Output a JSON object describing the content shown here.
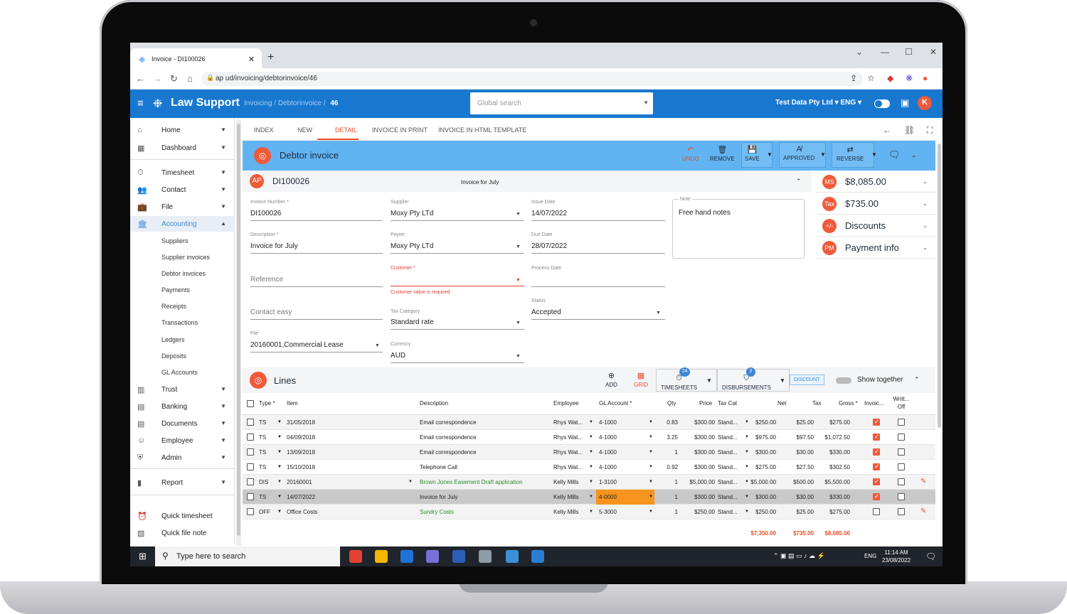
{
  "browser": {
    "tab_title": "Invoice - DI100026",
    "url": "ap          ud/invoicing/debtorinvoice/46"
  },
  "appbar": {
    "brand": "Law Support",
    "breadcrumb": [
      "Invoicing",
      "/",
      "Debtorinvoice",
      "/",
      "46"
    ],
    "search_placeholder": "Global search",
    "org": "Test Data Pty Ltd",
    "lang": "ENG",
    "avatar": "K"
  },
  "sidebar": {
    "items": [
      {
        "label": "Home",
        "icon": "home-icon"
      },
      {
        "label": "Dashboard",
        "icon": "dashboard-icon"
      },
      {
        "label": "Timesheet",
        "icon": "stopwatch-icon"
      },
      {
        "label": "Contact",
        "icon": "people-icon"
      },
      {
        "label": "File",
        "icon": "briefcase-icon"
      },
      {
        "label": "Accounting",
        "icon": "bank-icon"
      }
    ],
    "accounting_sub": [
      "Suppliers",
      "Supplier invoices",
      "Debtor invoices",
      "Payments",
      "Receipts",
      "Transactions",
      "Ledgers",
      "Deposits",
      "GL Accounts"
    ],
    "lower": [
      {
        "label": "Trust",
        "icon": "building-icon"
      },
      {
        "label": "Banking",
        "icon": "card-icon"
      },
      {
        "label": "Documents",
        "icon": "document-icon"
      },
      {
        "label": "Employee",
        "icon": "employee-icon"
      },
      {
        "label": "Admin",
        "icon": "shield-icon"
      },
      {
        "label": "Report",
        "icon": "report-icon"
      }
    ],
    "quick": [
      {
        "label": "Quick timesheet",
        "icon": "alarm-icon"
      },
      {
        "label": "Quick file note",
        "icon": "filenote-icon"
      }
    ]
  },
  "page_tabs": [
    "INDEX",
    "NEW",
    "DETAIL",
    "INVOICE IN PRINT",
    "INVOICE IN HTML TEMPLATE"
  ],
  "header": {
    "title": "Debtor invoice",
    "undo": "UNDO",
    "remove": "REMOVE",
    "save": "SAVE",
    "approved": "APPROVED",
    "reverse": "REVERSE"
  },
  "invoice": {
    "badge": "AP",
    "number": "DI100026",
    "subtitle": "Invoice for July",
    "fields": {
      "invoice_number_label": "Invoice Number *",
      "invoice_number": "DI100026",
      "supplier_label": "Supplier",
      "supplier": "Moxy Pty LTd",
      "issue_date_label": "Issue Date",
      "issue_date": "14/07/2022",
      "description_label": "Description *",
      "description": "Invoice for July",
      "payee_label": "Payee",
      "payee": "Moxy Pty LTd",
      "due_date_label": "Due Date",
      "due_date": "28/07/2022",
      "reference_ph": "Reference",
      "customer_label": "Customer *",
      "customer_error": "Customer value is required",
      "process_date_label": "Process Date",
      "contact_ph": "Contact easy",
      "tax_category_label": "Tax Category",
      "tax_category": "Standard rate",
      "status_label": "Status",
      "status": "Accepted",
      "file_label": "File",
      "file": "20160001,Commercial Lease",
      "currency_label": "Currency",
      "currency": "AUD",
      "note_label": "Note",
      "note": "Free hand notes"
    }
  },
  "summary": [
    {
      "badge": "MS",
      "label": "$8,085.00"
    },
    {
      "badge": "Tax",
      "label": "$735.00"
    },
    {
      "badge": "+/-",
      "label": "Discounts"
    },
    {
      "badge": "PM",
      "label": "Payment info"
    }
  ],
  "lines": {
    "title": "Lines",
    "add": "ADD",
    "grid": "GRID",
    "timesheets": "TIMESHEETS",
    "timesheets_count": "24",
    "disbursements": "DISBURSEMENTS",
    "disbursements_count": "2",
    "discount": "DISCOUNT",
    "show_together": "Show together",
    "headers": [
      "Type *",
      "Item",
      "Description",
      "Employee",
      "GL Account *",
      "Qty",
      "Price",
      "Tax Cat",
      "Net",
      "Tax",
      "Gross *",
      "Invoic...",
      "Writt... Off"
    ],
    "rows": [
      {
        "type": "TS",
        "item": "31/05/2018",
        "desc": "Email correspondence",
        "emp": "Rhys Wat...",
        "gl": "4-1000",
        "qty": "0.83",
        "price": "$300.00",
        "taxcat": "Stand...",
        "net": "$250.00",
        "tax": "$25.00",
        "gross": "$275.00",
        "inv": true
      },
      {
        "type": "TS",
        "item": "04/09/2018",
        "desc": "Email correspondence",
        "emp": "Rhys Wat...",
        "gl": "4-1000",
        "qty": "3.25",
        "price": "$300.00",
        "taxcat": "Stand...",
        "net": "$975.00",
        "tax": "$97.50",
        "gross": "$1,072.50",
        "inv": true
      },
      {
        "type": "TS",
        "item": "13/09/2018",
        "desc": "Email correspondence",
        "emp": "Rhys Wat...",
        "gl": "4-1000",
        "qty": "1",
        "price": "$300.00",
        "taxcat": "Stand...",
        "net": "$300.00",
        "tax": "$30.00",
        "gross": "$330.00",
        "inv": true
      },
      {
        "type": "TS",
        "item": "15/10/2018",
        "desc": "Telephone Call",
        "emp": "Rhys Wat...",
        "gl": "4-1000",
        "qty": "0.92",
        "price": "$300.00",
        "taxcat": "Stand...",
        "net": "$275.00",
        "tax": "$27.50",
        "gross": "$302.50",
        "inv": true
      },
      {
        "type": "DIS",
        "item": "20160001",
        "desc": "Brown Jones Easement Draft application",
        "emp": "Kelly Mills",
        "gl": "1-3100",
        "qty": "1",
        "price": "$5,000.00",
        "taxcat": "Stand...",
        "net": "$5,000.00",
        "tax": "$500.00",
        "gross": "$5,500.00",
        "inv": true
      },
      {
        "type": "TS",
        "item": "14/07/2022",
        "desc": "Invoice for July",
        "emp": "Kelly Mills",
        "gl": "4-0000",
        "qty": "1",
        "price": "$300.00",
        "taxcat": "Stand...",
        "net": "$300.00",
        "tax": "$30.00",
        "gross": "$330.00",
        "inv": true
      },
      {
        "type": "OFF",
        "item": "Office Costs",
        "desc": "Sundry Costs",
        "emp": "Kelly Mills",
        "gl": "5-3000",
        "qty": "1",
        "price": "$250.00",
        "taxcat": "Stand...",
        "net": "$250.00",
        "tax": "$25.00",
        "gross": "$275.00",
        "inv": false
      }
    ],
    "totals": {
      "net": "$7,350.00",
      "tax": "$735.00",
      "gross": "$8,085.00"
    }
  },
  "taskbar": {
    "search_placeholder": "Type here to search",
    "lang": "ENG",
    "time": "11:14 AM",
    "date": "23/08/2022"
  }
}
